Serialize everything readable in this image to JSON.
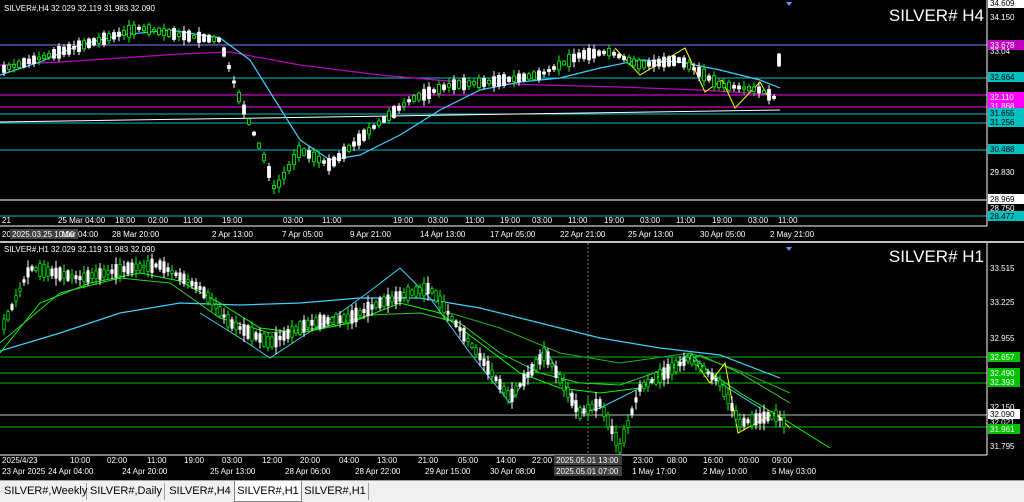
{
  "tabs": [
    "SILVER#,Weekly",
    "SILVER#,Daily",
    "SILVER#,H4",
    "SILVER#,H1",
    "SILVER#,H1"
  ],
  "active_tab": 3,
  "chart1": {
    "title": "SILVER# H4",
    "info": "SILVER#,H4  32.029 32.119 31.983 32.090",
    "price_labels": [
      {
        "text": "34.609",
        "bg": "#ffffff",
        "fg": "#000000"
      },
      {
        "text": "34.150",
        "bg": "#000000",
        "fg": "#ffffff"
      },
      {
        "text": "33.678",
        "bg": "#c000c0",
        "fg": "#ffffff"
      },
      {
        "text": "33.04",
        "bg": "#000000",
        "fg": "#ffffff"
      },
      {
        "text": "32.664",
        "bg": "#00c0c0",
        "fg": "#000000"
      },
      {
        "text": "32.110",
        "bg": "#ff00ff",
        "fg": "#ffffff"
      },
      {
        "text": "31.868",
        "bg": "#ff00ff",
        "fg": "#ffffff"
      },
      {
        "text": "31.655",
        "bg": "#00c0c0",
        "fg": "#000000"
      },
      {
        "text": "31.256",
        "bg": "#00c0c0",
        "fg": "#000000"
      },
      {
        "text": "30.488",
        "bg": "#00c0c0",
        "fg": "#000000"
      },
      {
        "text": "29.830",
        "bg": "#000000",
        "fg": "#ffffff"
      },
      {
        "text": "28.969",
        "bg": "#ffffff",
        "fg": "#000000"
      },
      {
        "text": "28.750",
        "bg": "#000000",
        "fg": "#ffffff"
      },
      {
        "text": "28.477",
        "bg": "#00c0c0",
        "fg": "#000000"
      }
    ],
    "time_labels": [
      "21",
      "25 Mar 04:00",
      "18:00",
      "02:00",
      "11:00",
      "19:00",
      "03:00",
      "11:00",
      "19:00",
      "03:00",
      "11:00",
      "19:00",
      "03:00",
      "11:00",
      "19:00",
      "03:00",
      "11:00",
      "19:00",
      "03:00",
      "11:00",
      "19:00",
      "03:00"
    ],
    "time_labels2": [
      "20",
      "2025.03.25 10:00",
      "Mar 04:00",
      "28 Mar 20:00",
      "2 Apr 13:00",
      "7 Apr 05:00",
      "9 Apr 21:00",
      "14 Apr 13:00",
      "17 Apr 05:00",
      "22 Apr 21:00",
      "25 Apr 13:00",
      "30 Apr 05:00",
      "2 May 21:00"
    ]
  },
  "chart2": {
    "title": "SILVER# H1",
    "info": "SILVER#,H1  32.029 32.119 31.983 32.090",
    "price_labels": [
      {
        "text": "33.515",
        "bg": "#000000",
        "fg": "#ffffff"
      },
      {
        "text": "33.225",
        "bg": "#000000",
        "fg": "#ffffff"
      },
      {
        "text": "32.955",
        "bg": "#000000",
        "fg": "#ffffff"
      },
      {
        "text": "32.657",
        "bg": "#00c000",
        "fg": "#ffffff"
      },
      {
        "text": "32.490",
        "bg": "#00c000",
        "fg": "#ffffff"
      },
      {
        "text": "32.393",
        "bg": "#00c000",
        "fg": "#ffffff"
      },
      {
        "text": "32.150",
        "bg": "#000000",
        "fg": "#ffffff"
      },
      {
        "text": "32.090",
        "bg": "#ffffff",
        "fg": "#000000"
      },
      {
        "text": "32.021",
        "bg": "#000000",
        "fg": "#ffffff"
      },
      {
        "text": "31.961",
        "bg": "#00c000",
        "fg": "#ffffff"
      },
      {
        "text": "31.795",
        "bg": "#000000",
        "fg": "#ffffff"
      }
    ],
    "time_labels": [
      "2025/4/23",
      "10:00",
      "02:00",
      "11:00",
      "19:00",
      "03:00",
      "12:00",
      "20:00",
      "04:00",
      "13:00",
      "21:00",
      "05:00",
      "14:00",
      "22:00",
      "2025.05.01 13:00",
      "23:00",
      "08:00",
      "16:00",
      "00:00",
      "09:00"
    ],
    "time_labels2": [
      "23 Apr 2025",
      "24 Apr 04:00",
      "24 Apr 20:00",
      "25 Apr 13:00",
      "28 Apr 06:00",
      "28 Apr 22:00",
      "29 Apr 15:00",
      "30 Apr 08:00",
      "2025.05.01 07:00",
      "1 May 17:00",
      "2 May 10:00",
      "5 May 03:00"
    ]
  }
}
